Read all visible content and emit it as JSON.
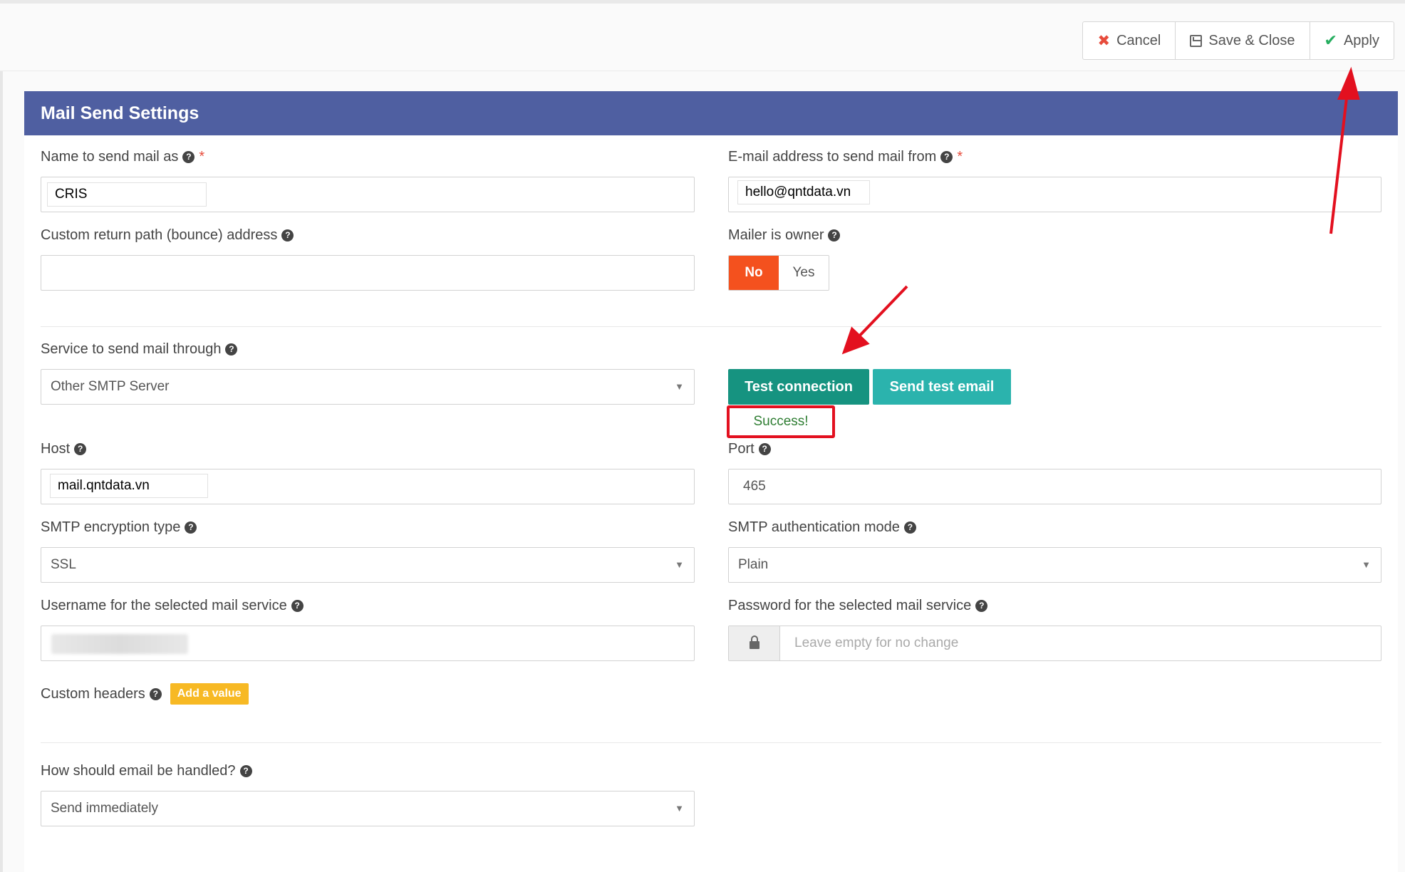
{
  "toolbar": {
    "cancel_label": "Cancel",
    "save_close_label": "Save & Close",
    "apply_label": "Apply"
  },
  "card": {
    "title": "Mail Send Settings"
  },
  "fields": {
    "from_name": {
      "label": "Name to send mail as",
      "value": "CRIS"
    },
    "from_email": {
      "label": "E-mail address to send mail from",
      "value": "hello@qntdata.vn"
    },
    "return_path": {
      "label": "Custom return path (bounce) address",
      "value": ""
    },
    "mailer_is_owner": {
      "label": "Mailer is owner",
      "options": [
        "No",
        "Yes"
      ],
      "selected": "No"
    },
    "service": {
      "label": "Service to send mail through",
      "value": "Other SMTP Server"
    },
    "host": {
      "label": "Host",
      "value": "mail.qntdata.vn"
    },
    "port": {
      "label": "Port",
      "value": "465"
    },
    "encryption": {
      "label": "SMTP encryption type",
      "value": "SSL"
    },
    "auth_mode": {
      "label": "SMTP authentication mode",
      "value": "Plain"
    },
    "username": {
      "label": "Username for the selected mail service",
      "value": ""
    },
    "password": {
      "label": "Password for the selected mail service",
      "placeholder": "Leave empty for no change"
    },
    "custom_headers": {
      "label": "Custom headers",
      "add_label": "Add a value"
    },
    "handling": {
      "label": "How should email be handled?",
      "value": "Send immediately"
    }
  },
  "actions": {
    "test_connection_label": "Test connection",
    "send_test_email_label": "Send test email",
    "status": "Success!"
  },
  "colors": {
    "header_bg": "#4f5fa1",
    "active_toggle": "#f4511e",
    "test_connection": "#169380",
    "send_test_email": "#2bb3ad",
    "success_text": "#2e7d32",
    "annotation_red": "#e3101f",
    "add_button": "#f7b924"
  }
}
